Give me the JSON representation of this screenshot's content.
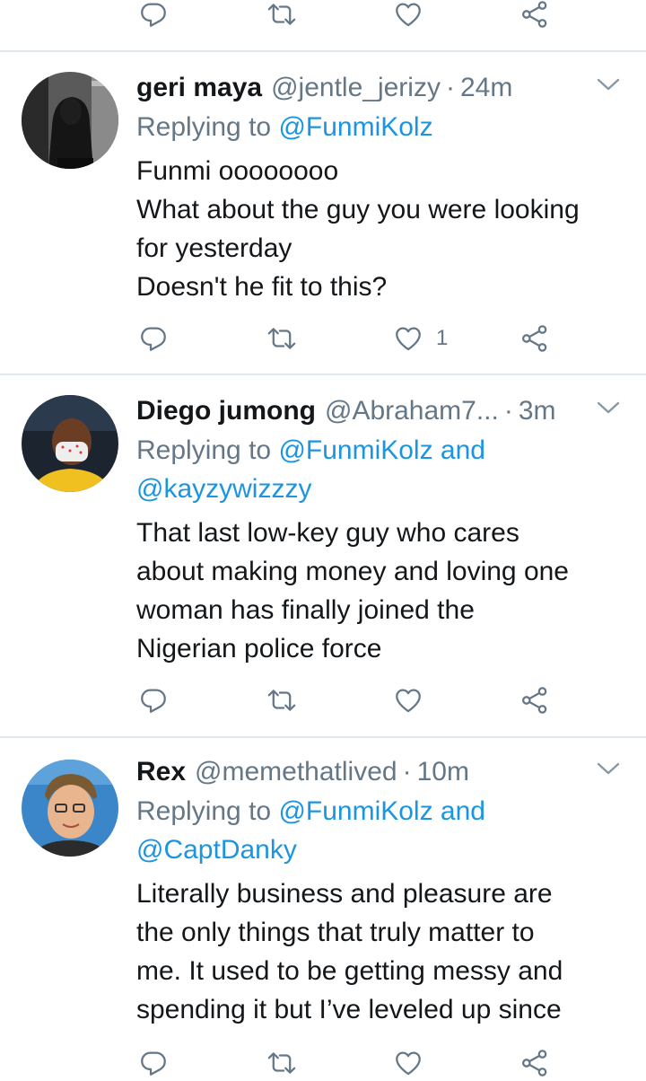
{
  "colors": {
    "link": "#1b95e0",
    "secondary": "#657786",
    "divider": "#e1e8ed",
    "text": "#14171a"
  },
  "icons": {
    "reply": "reply-icon",
    "retweet": "retweet-icon",
    "like": "heart-icon",
    "share": "share-icon",
    "more": "chevron-down-icon"
  },
  "top_actions": {
    "like_count": ""
  },
  "tweets": [
    {
      "name": "geri maya",
      "handle": "@jentle_jerizy",
      "time": "24m",
      "reply_prefix": "Replying to ",
      "reply_to": "@FunmiKolz",
      "reply_to_2": "",
      "body": [
        "Funmi oooooooo",
        "What about the guy you were looking",
        "for yesterday",
        "Doesn't he fit to this?"
      ],
      "like_count": "1"
    },
    {
      "name": "Diego jumong",
      "handle": "@Abraham7...",
      "time": "3m",
      "reply_prefix": "Replying to ",
      "reply_to": "@FunmiKolz and",
      "reply_to_2": "@kayzywizzzy",
      "body": [
        "That last low-key guy who cares",
        "about making money and loving one",
        "woman has finally joined the",
        "Nigerian police force"
      ],
      "like_count": ""
    },
    {
      "name": "Rex",
      "handle": "@memethatlived",
      "time": "10m",
      "reply_prefix": "Replying to ",
      "reply_to": "@FunmiKolz and",
      "reply_to_2": "@CaptDanky",
      "body": [
        "Literally business and pleasure are",
        "the only things that truly matter to",
        "me. It used to be getting messy and",
        "spending it but I’ve leveled up since"
      ],
      "like_count": ""
    }
  ]
}
